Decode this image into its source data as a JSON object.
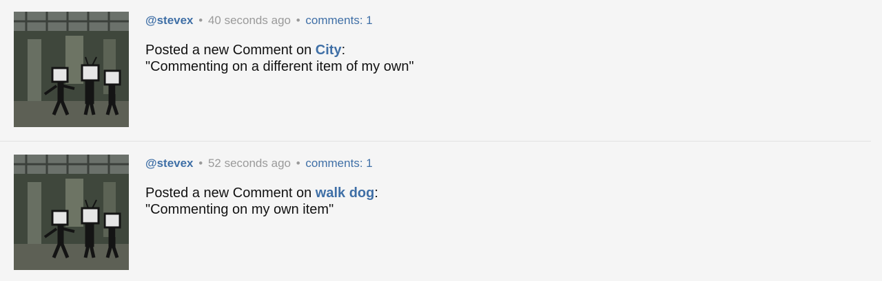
{
  "feed": {
    "items": [
      {
        "username": "@stevex",
        "time": "40 seconds ago",
        "comments": "comments: 1",
        "action_prefix": "Posted a new Comment on ",
        "target": "City",
        "action_suffix": ":",
        "quote": "\"Commenting on a different item of my own\""
      },
      {
        "username": "@stevex",
        "time": "52 seconds ago",
        "comments": "comments: 1",
        "action_prefix": "Posted a new Comment on ",
        "target": "walk dog",
        "action_suffix": ":",
        "quote": "\"Commenting on my own item\""
      }
    ],
    "separator": "•"
  },
  "colors": {
    "link": "#3f6fa6",
    "meta": "#9a9a9a",
    "background": "#f5f5f5"
  }
}
